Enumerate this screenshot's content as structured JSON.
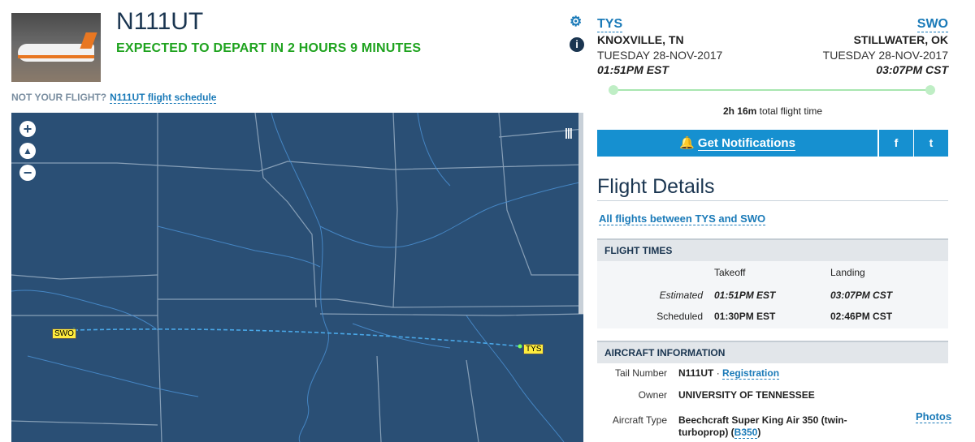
{
  "flight": {
    "tail": "N111UT",
    "status": "EXPECTED TO DEPART IN 2 HOURS 9 MINUTES",
    "not_your_flight": "NOT YOUR FLIGHT?",
    "schedule_link": "N111UT flight schedule"
  },
  "map": {
    "zoom_in": "+",
    "zoom_out": "−",
    "origin_label": "TYS",
    "destination_label": "SWO",
    "colors": {
      "water": "#2a4f75",
      "route": "#4aa8e8",
      "label_bg": "#ffec3d"
    }
  },
  "origin": {
    "code": "TYS",
    "city": "KNOXVILLE, TN",
    "date": "TUESDAY 28-NOV-2017",
    "time": "01:51PM EST"
  },
  "destination": {
    "code": "SWO",
    "city": "STILLWATER, OK",
    "date": "TUESDAY 28-NOV-2017",
    "time": "03:07PM CST"
  },
  "total": {
    "duration": "2h 16m",
    "suffix": "total flight time"
  },
  "notifications": {
    "label": "Get Notifications",
    "facebook": "f",
    "twitter": "t"
  },
  "details": {
    "title": "Flight Details",
    "all_flights": "All flights between TYS and SWO",
    "flight_times_header": "FLIGHT TIMES",
    "col_takeoff": "Takeoff",
    "col_landing": "Landing",
    "rows": [
      {
        "label": "Estimated",
        "takeoff": "01:51PM EST",
        "landing": "03:07PM CST"
      },
      {
        "label": "Scheduled",
        "takeoff": "01:30PM EST",
        "landing": "02:46PM CST"
      }
    ],
    "aircraft_header": "AIRCRAFT INFORMATION",
    "tail_label": "Tail Number",
    "tail_value": "N111UT",
    "tail_sep": " · ",
    "registration_link": "Registration",
    "owner_label": "Owner",
    "owner_value": "UNIVERSITY OF TENNESSEE",
    "type_label": "Aircraft Type",
    "type_value_line1": "Beechcraft Super King Air 350 (twin-",
    "type_value_line2": "turboprop) (",
    "type_code": "B350",
    "type_close": ")",
    "photos_link": "Photos"
  },
  "accent": "#1690d0",
  "status_color": "#1fa31f"
}
